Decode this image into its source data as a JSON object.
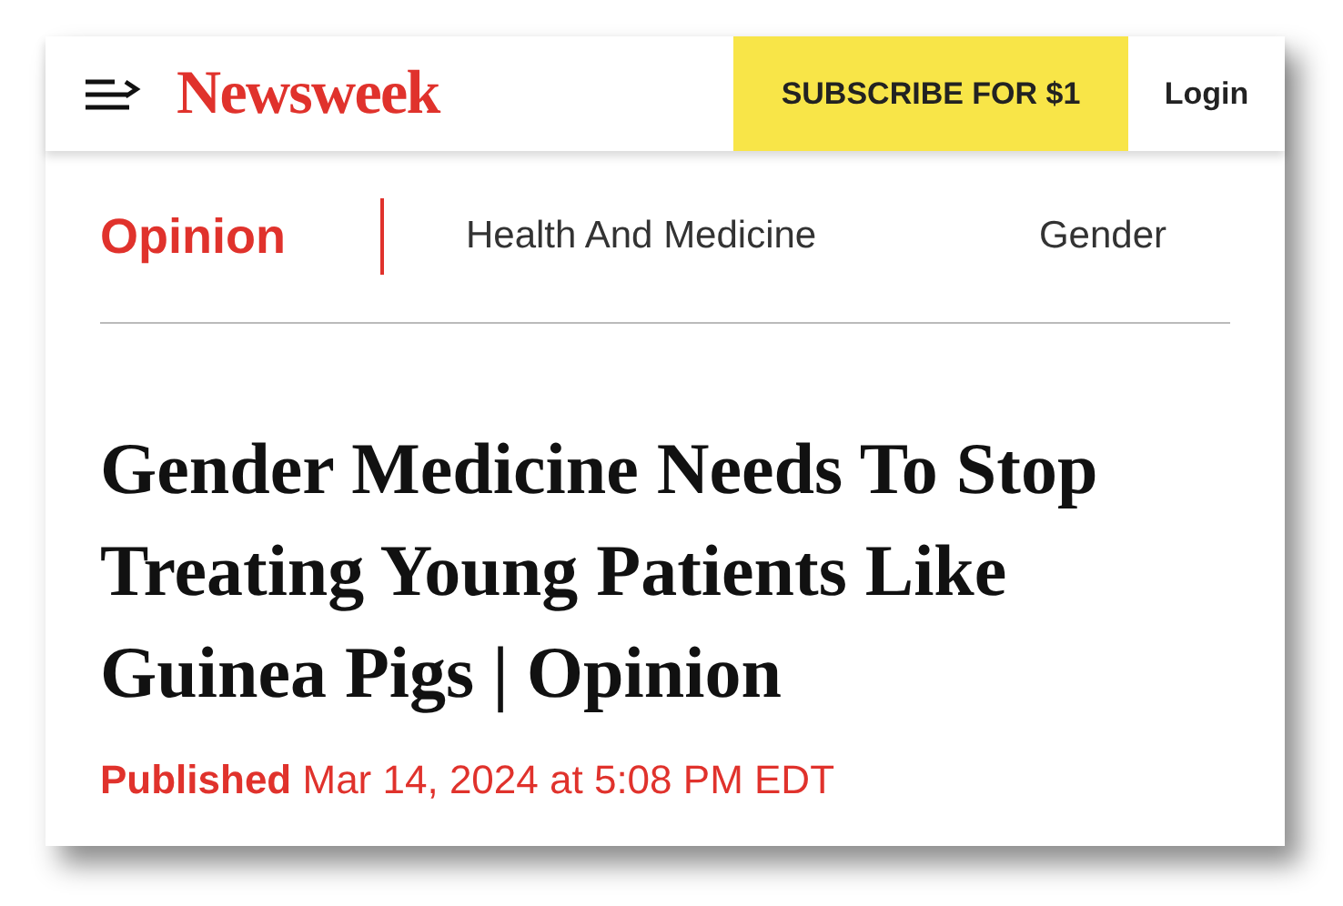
{
  "header": {
    "logo": "Newsweek",
    "subscribe": "SUBSCRIBE FOR $1",
    "login": "Login"
  },
  "nav": [
    {
      "label": "Opinion",
      "selected": true
    },
    {
      "label": "Health And Medicine",
      "selected": false
    },
    {
      "label": "Gender",
      "selected": false
    }
  ],
  "article": {
    "title": "Gender Medicine Needs To Stop Treating Young Patients Like Guinea Pigs | Opinion",
    "published_label": "Published",
    "published_date": "Mar 14, 2024 at 5:08 PM EDT"
  }
}
